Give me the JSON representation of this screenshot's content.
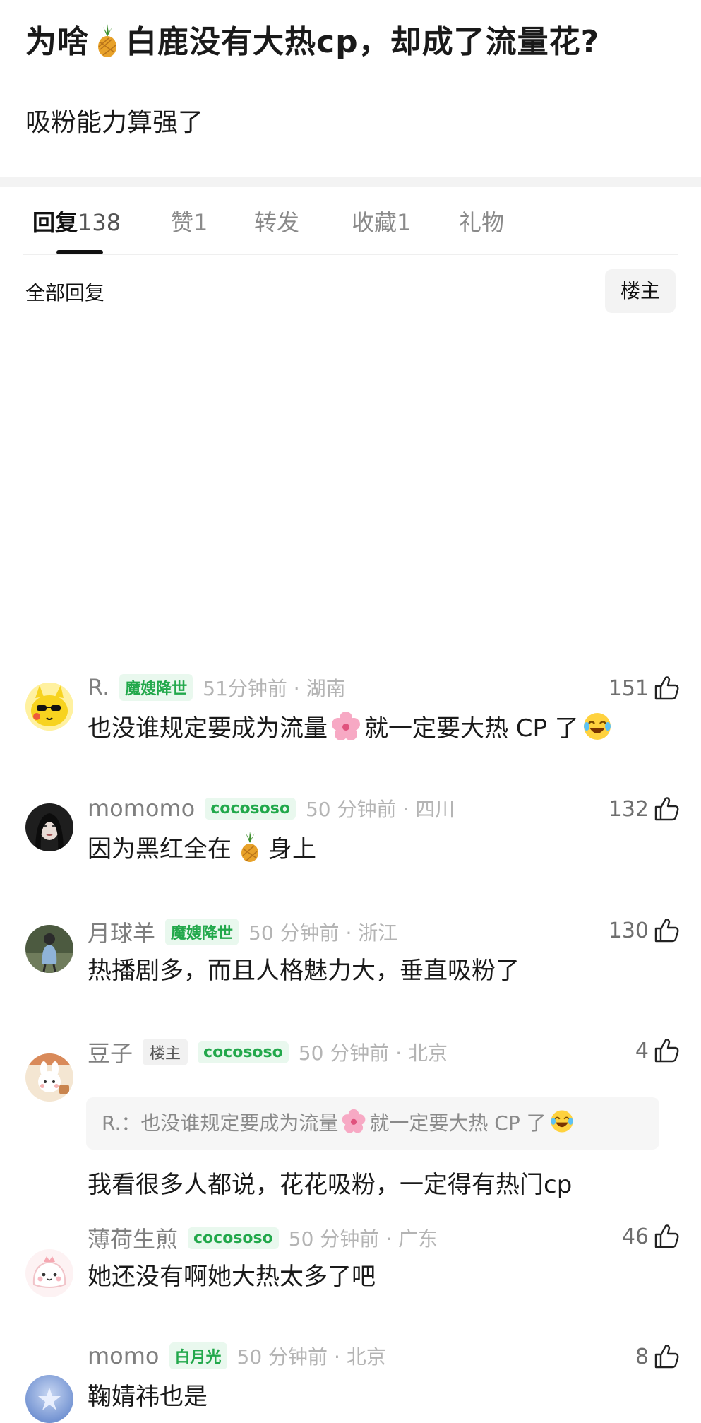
{
  "post": {
    "title_before": "为啥",
    "title_after": "白鹿没有大热cp，却成了流量花?",
    "subtitle": "吸粉能力算强了"
  },
  "tabs": [
    {
      "label": "回复",
      "count": "138"
    },
    {
      "label": "赞1"
    },
    {
      "label": "转发"
    },
    {
      "label": "收藏1"
    },
    {
      "label": "礼物"
    }
  ],
  "section": {
    "title": "全部回复",
    "filter_label": "楼主"
  },
  "comments": [
    {
      "username": "R.",
      "badges": [
        "魔嫂降世"
      ],
      "time_location": "51分钟前 · 湖南",
      "likes": "151",
      "text_1": "也没谁规定要成为流量",
      "text_2": "就一定要大热 CP 了"
    },
    {
      "username": "momomo",
      "badges": [
        "cocososo"
      ],
      "time_location": "50 分钟前 · 四川",
      "likes": "132",
      "text_1": "因为黑红全在",
      "text_2": "身上"
    },
    {
      "username": "月球羊",
      "badges": [
        "魔嫂降世"
      ],
      "time_location": "50 分钟前 · 浙江",
      "likes": "130",
      "text": "热播剧多，而且人格魅力大，垂直吸粉了"
    },
    {
      "username": "豆子",
      "op_badge": "楼主",
      "badges": [
        "cocososo"
      ],
      "time_location": "50 分钟前 · 北京",
      "likes": "4",
      "quote": {
        "author": "R.：",
        "text_1": "也没谁规定要成为流量",
        "text_2": "就一定要大热 CP 了"
      },
      "text": "我看很多人都说，花花吸粉，一定得有热门cp"
    },
    {
      "username": "薄荷生煎",
      "badges": [
        "cocososo"
      ],
      "time_location": "50 分钟前 · 广东",
      "likes": "46",
      "text": "她还没有啊她大热太多了吧"
    },
    {
      "username": "momo",
      "badges": [
        "白月光"
      ],
      "time_location": "50 分钟前 · 北京",
      "likes": "8",
      "text": "鞠婧祎也是"
    }
  ],
  "colors": {
    "badge_green": "#22a84b",
    "badge_green_bg": "#e9f8ee",
    "meta_grey": "#b4b4b4",
    "text": "#1a1a1a"
  },
  "icons": [
    "pineapple-emoji",
    "cherry-blossom-emoji",
    "laughing-tears-emoji",
    "thumbs-up-icon"
  ]
}
